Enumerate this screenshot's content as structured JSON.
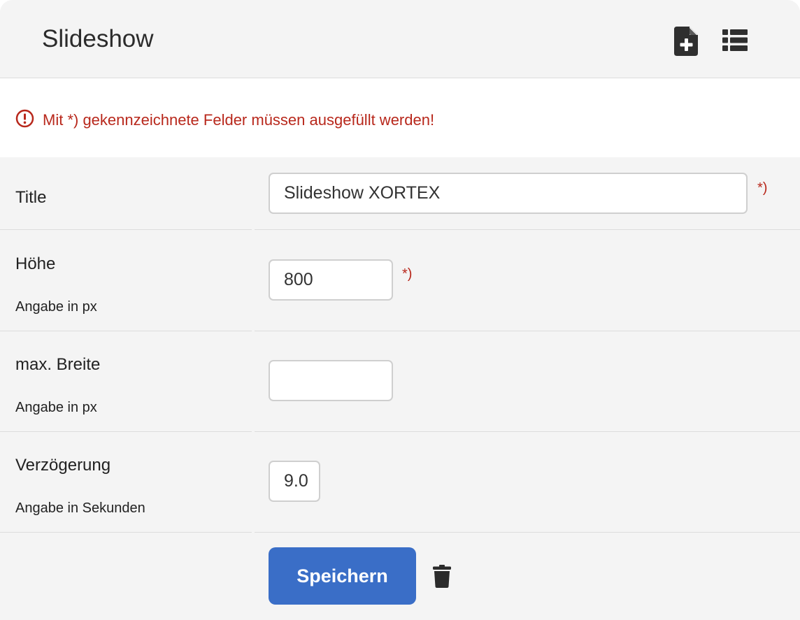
{
  "header": {
    "title": "Slideshow",
    "new_icon": "file-plus-icon",
    "list_icon": "list-icon"
  },
  "notice": {
    "icon": "exclamation-circle-icon",
    "text": "Mit *) gekennzeichnete Felder müssen ausgefüllt werden!",
    "color": "#b8281c"
  },
  "form": {
    "title": {
      "label": "Title",
      "value": "Slideshow XORTEX",
      "required_marker": "*)"
    },
    "height": {
      "label": "Höhe",
      "hint": "Angabe in px",
      "value": "800",
      "required_marker": "*)"
    },
    "max_width": {
      "label": "max. Breite",
      "hint": "Angabe in px",
      "value": ""
    },
    "delay": {
      "label": "Verzögerung",
      "hint": "Angabe in Sekunden",
      "value": "9.0"
    }
  },
  "actions": {
    "save_label": "Speichern",
    "save_color": "#3a6ec7",
    "delete_icon": "trash-icon"
  }
}
